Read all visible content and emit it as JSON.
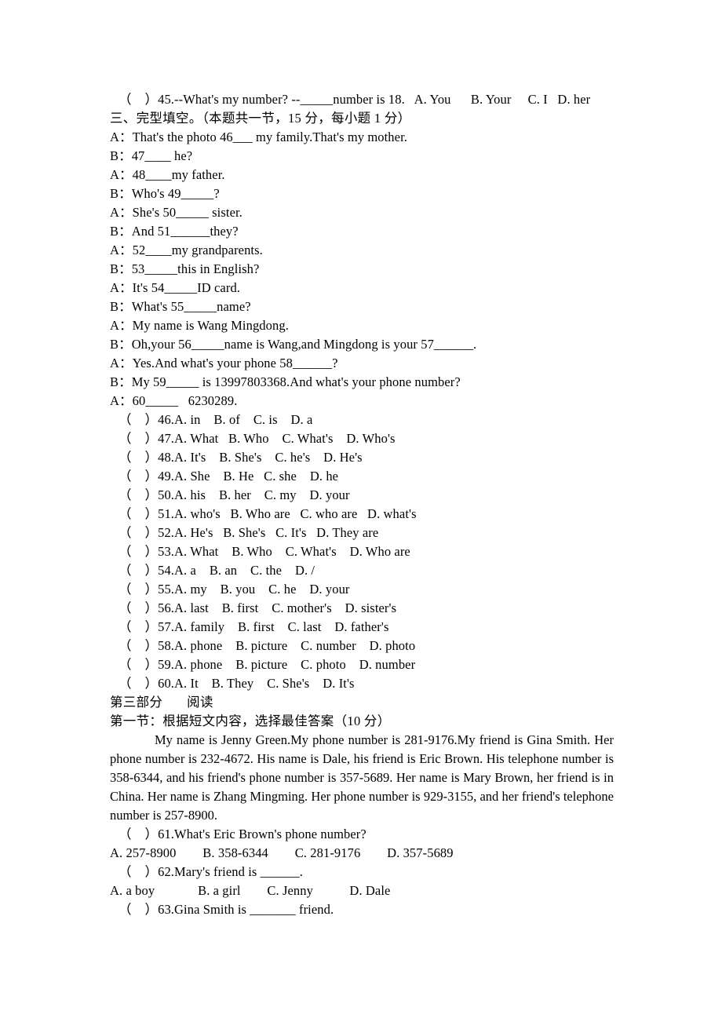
{
  "document": {
    "type": "exam-paper",
    "language": "zh-CN/en",
    "q45_line": "（    ）45.--What's my number? --_____number is 18.   A. You      B. Your     C. I   D. her",
    "section_three_heading": "三、完型填空。（本题共一节，15 分，每小题 1 分）",
    "dialogue": [
      "A：That's the photo 46___ my family.That's my mother.",
      "B：47____ he?",
      "A：48____my father.",
      "B：Who's 49_____?",
      "A：She's 50_____ sister.",
      "B：And 51______they?",
      "A：52____my grandparents.",
      "B：53_____this in English?",
      "A：It's 54_____ID card.",
      "B：What's 55_____name?",
      "A：My name is Wang Mingdong.",
      "B：Oh,your 56_____name is Wang,and Mingdong is your 57______.",
      "A：Yes.And what's your phone 58______?",
      "B：My 59_____ is 13997803368.And what's your phone number?",
      "A：60_____   6230289."
    ],
    "cloze_options": [
      "（    ）46.A. in    B. of    C. is    D. a",
      "（    ）47.A. What   B. Who    C. What's    D. Who's",
      "（    ）48.A. It's    B. She's    C. he's    D. He's",
      "（    ）49.A. She    B. He   C. she    D. he",
      "（    ）50.A. his    B. her    C. my    D. your",
      "（    ）51.A. who's   B. Who are   C. who are   D. what's",
      "（    ）52.A. He's   B. She's   C. It's   D. They are",
      "（    ）53.A. What    B. Who    C. What's    D. Who are",
      "（    ）54.A. a    B. an    C. the    D. /",
      "（    ）55.A. my    B. you    C. he    D. your",
      "（    ）56.A. last    B. first    C. mother's    D. sister's",
      "（    ）57.A. family    B. first    C. last    D. father's",
      "（    ）58.A. phone    B. picture    C. number    D. photo",
      "（    ）59.A. phone    B. picture    C. photo    D. number",
      "（    ）60.A. It    B. They    C. She's    D. It's"
    ],
    "part_three_heading": "第三部分       阅读",
    "part_three_section_one": "第一节：根据短文内容，选择最佳答案（10 分）",
    "reading_passage": "My name is Jenny Green.My phone number is 281-9176.My friend is Gina Smith. Her phone number is 232-4672. His name is Dale, his friend is Eric Brown. His telephone number is 358-6344, and his friend's phone number is 357-5689. Her name is Mary Brown, her friend is in China. Her name is Zhang Mingming. Her phone number is 929-3155, and her friend's telephone number is 257-8900.",
    "reading_questions": [
      {
        "stem": "（    ）61.What's Eric Brown's phone number?",
        "options": "A. 257-8900        B. 358-6344        C. 281-9176        D. 357-5689"
      },
      {
        "stem": "（    ）62.Mary's friend is ______.",
        "options": "A. a boy             B. a girl        C. Jenny           D. Dale"
      },
      {
        "stem": "（    ）63.Gina Smith is _______ friend.",
        "options": ""
      }
    ]
  }
}
